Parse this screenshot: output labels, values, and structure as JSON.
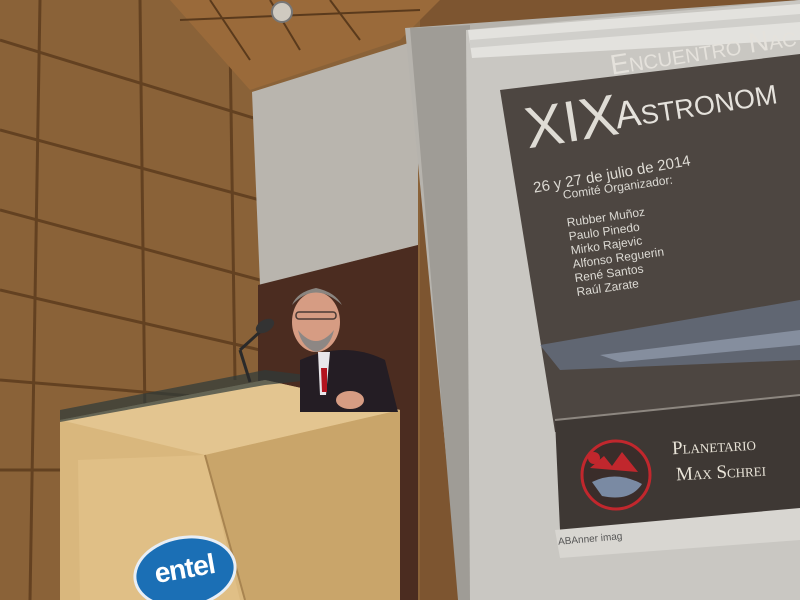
{
  "photo": {
    "description_scene": "speaker at podium with projected slide"
  },
  "slide": {
    "roman": "XIX",
    "line1": "Encuentro Nac",
    "line2": "Astronom",
    "date": "26 y 27 de julio de 2014",
    "committee_title": "Comité Organizador:",
    "committee": [
      "Rubber Muñoz",
      "Paulo Pinedo",
      "Mirko Rajevic",
      "Alfonso Reguerin",
      "René Santos",
      "Raúl Zarate"
    ],
    "logo_line1": "Planetario",
    "logo_line2": "Max Schrei",
    "status_bar": "ABAnner imag"
  },
  "podium": {
    "brand": "entel"
  },
  "colors": {
    "wall_wood": "#8a6238",
    "screen": "#c9c7c2",
    "slide_bg": "#4d4641",
    "podium_wood": "#d9b77d",
    "brand_blue": "#1b6fb5"
  }
}
